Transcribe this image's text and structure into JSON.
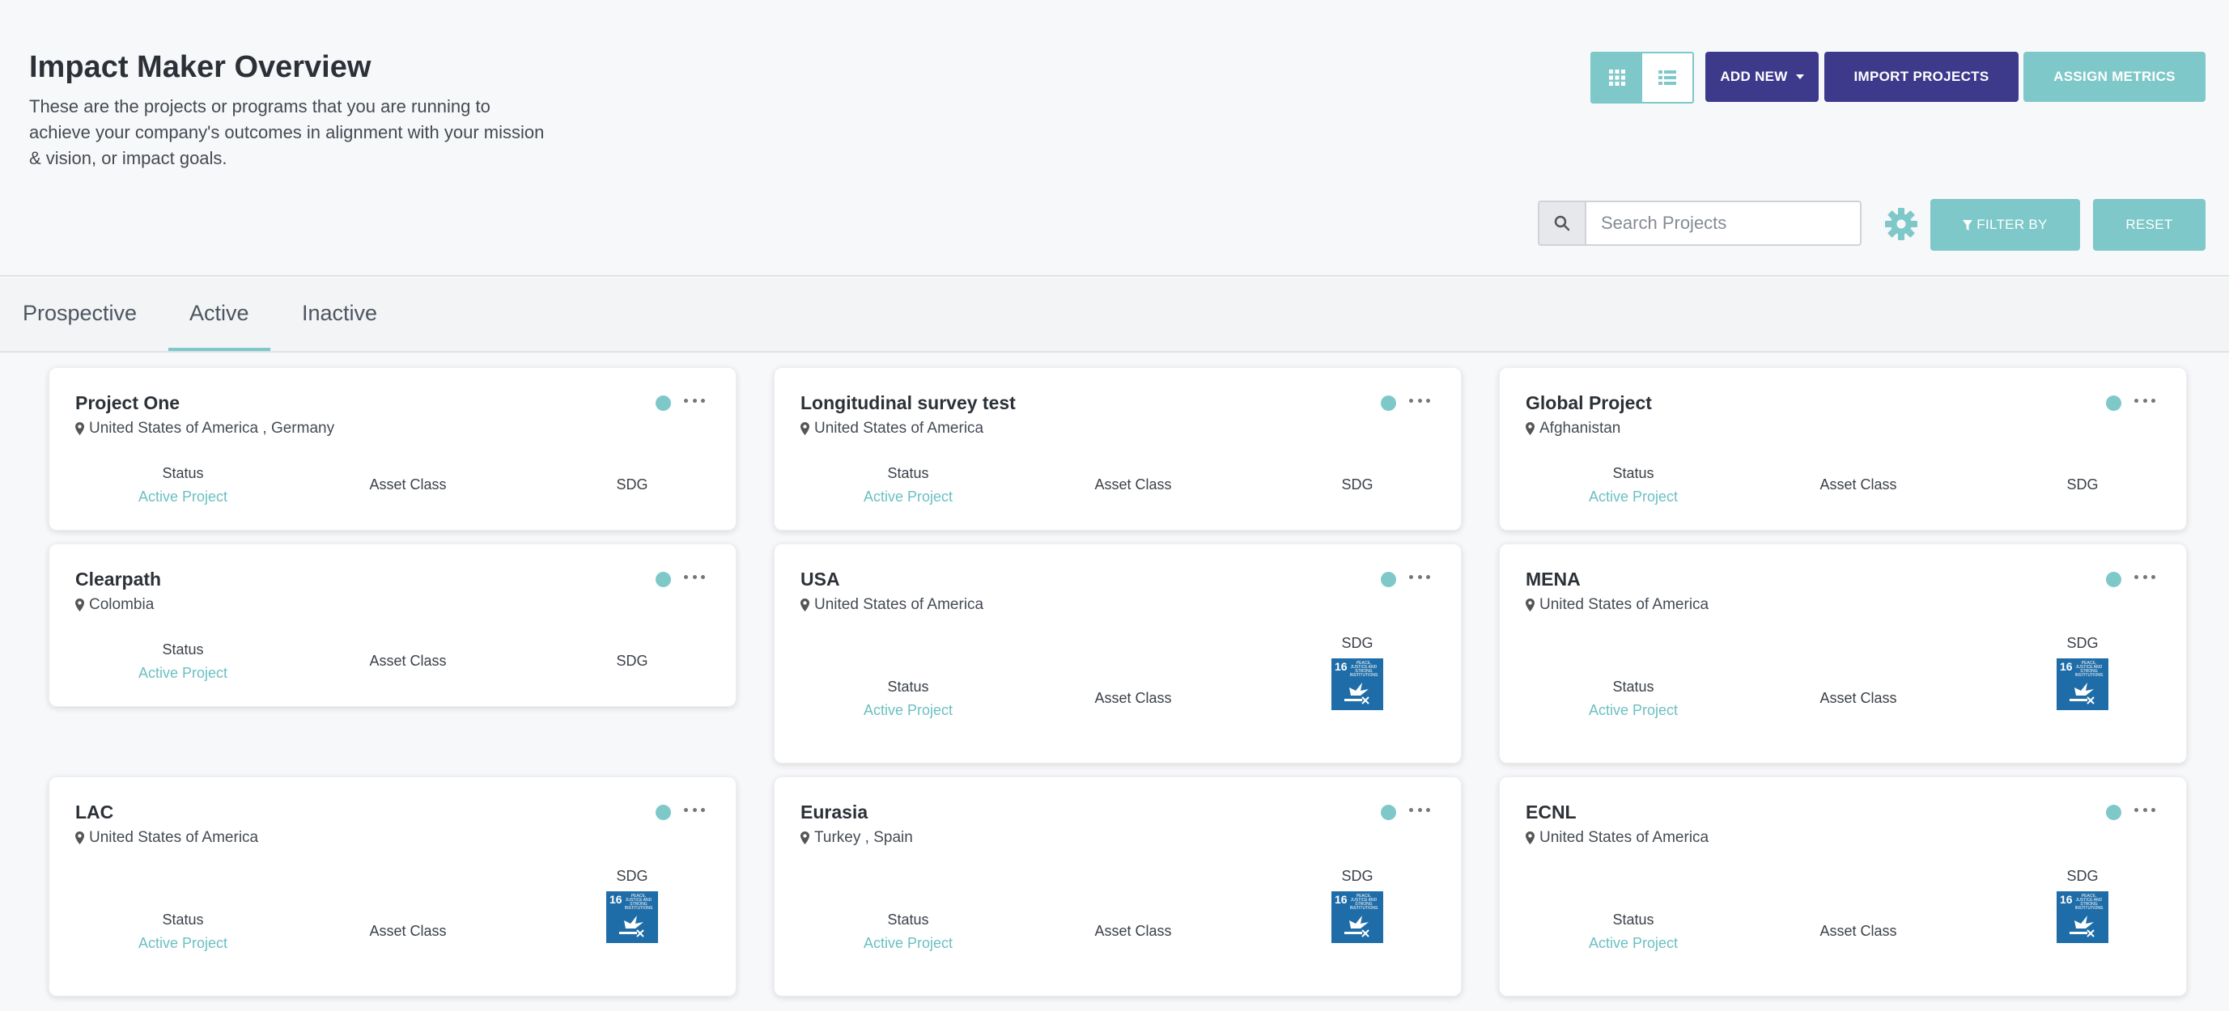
{
  "header": {
    "title": "Impact Maker Overview",
    "description": "These are the projects or programs that you are running to achieve your company's outcomes in alignment with your mission & vision, or impact goals."
  },
  "toolbar": {
    "grid_view_icon": "grid-icon",
    "list_view_icon": "list-icon",
    "add_new_label": "ADD NEW",
    "import_label": "IMPORT PROJECTS",
    "assign_label": "ASSIGN METRICS"
  },
  "search": {
    "placeholder": "Search Projects",
    "value": ""
  },
  "filters": {
    "filter_label": "FILTER BY",
    "reset_label": "RESET"
  },
  "tabs": [
    {
      "label": "Prospective"
    },
    {
      "label": "Active"
    },
    {
      "label": "Inactive"
    }
  ],
  "labels": {
    "status": "Status",
    "asset_class": "Asset Class",
    "sdg": "SDG"
  },
  "sdg_badge": {
    "number": "16",
    "text": "PEACE, JUSTICE AND STRONG INSTITUTIONS"
  },
  "projects": [
    {
      "name": "Project One",
      "location": "United States of America , Germany",
      "status": "Active Project"
    },
    {
      "name": "Longitudinal survey test",
      "location": "United States of America",
      "status": "Active Project"
    },
    {
      "name": "Global Project",
      "location": "Afghanistan",
      "status": "Active Project"
    },
    {
      "name": "Clearpath",
      "location": "Colombia",
      "status": "Active Project"
    },
    {
      "name": "USA",
      "location": "United States of America",
      "status": "Active Project"
    },
    {
      "name": "MENA",
      "location": "United States of America",
      "status": "Active Project"
    },
    {
      "name": "LAC",
      "location": "United States of America",
      "status": "Active Project"
    },
    {
      "name": "Eurasia",
      "location": "Turkey , Spain",
      "status": "Active Project"
    },
    {
      "name": "ECNL",
      "location": "United States of America",
      "status": "Active Project"
    }
  ],
  "colors": {
    "accent": "#7fc8c9",
    "primary": "#3d3a8c",
    "sdg16": "#1f6da8"
  }
}
